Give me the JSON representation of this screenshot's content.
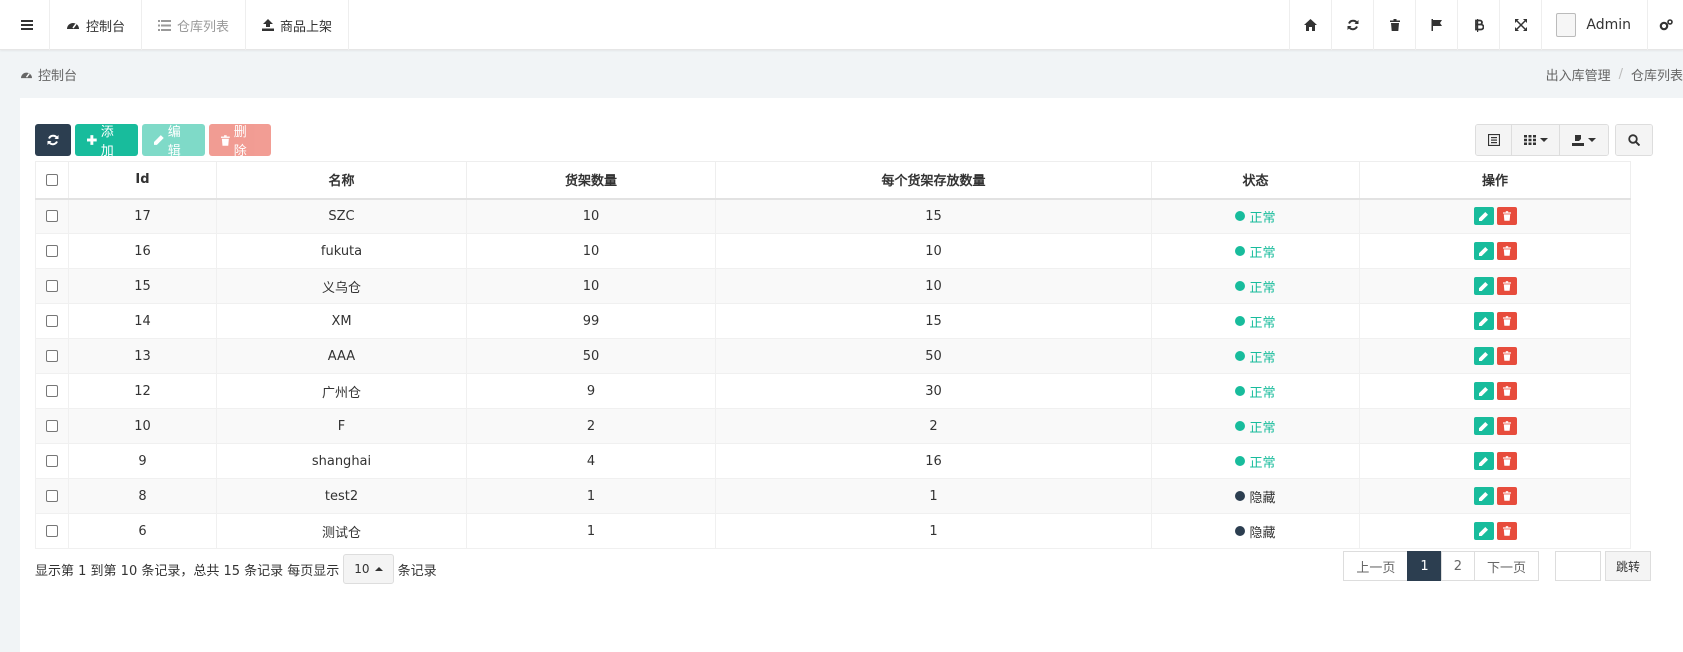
{
  "nav": {
    "tabs": [
      {
        "label": "控制台",
        "icon": "dashboard-icon",
        "active": true
      },
      {
        "label": "仓库列表",
        "icon": "list-icon",
        "active": false
      },
      {
        "label": "商品上架",
        "icon": "upload-icon",
        "active": true
      }
    ],
    "right_icons": [
      "home-icon",
      "refresh-icon",
      "trash-icon",
      "flag-icon",
      "bitcoin-icon",
      "fullscreen-icon"
    ],
    "user_name": "Admin"
  },
  "breadcrumb": {
    "left": "控制台",
    "right": [
      "出入库管理",
      "仓库列表"
    ]
  },
  "toolbar": {
    "add_label": "添加",
    "edit_label": "编辑",
    "delete_label": "删除"
  },
  "table": {
    "headers": [
      "Id",
      "名称",
      "货架数量",
      "每个货架存放数量",
      "状态",
      "操作"
    ],
    "rows": [
      {
        "id": "17",
        "name": "SZC",
        "shelves": "10",
        "per_shelf": "15",
        "status": "正常"
      },
      {
        "id": "16",
        "name": "fukuta",
        "shelves": "10",
        "per_shelf": "10",
        "status": "正常"
      },
      {
        "id": "15",
        "name": "义乌仓",
        "shelves": "10",
        "per_shelf": "10",
        "status": "正常"
      },
      {
        "id": "14",
        "name": "XM",
        "shelves": "99",
        "per_shelf": "15",
        "status": "正常"
      },
      {
        "id": "13",
        "name": "AAA",
        "shelves": "50",
        "per_shelf": "50",
        "status": "正常"
      },
      {
        "id": "12",
        "name": "广州仓",
        "shelves": "9",
        "per_shelf": "30",
        "status": "正常"
      },
      {
        "id": "10",
        "name": "F",
        "shelves": "2",
        "per_shelf": "2",
        "status": "正常"
      },
      {
        "id": "9",
        "name": "shanghai",
        "shelves": "4",
        "per_shelf": "16",
        "status": "正常"
      },
      {
        "id": "8",
        "name": "test2",
        "shelves": "1",
        "per_shelf": "1",
        "status": "隐藏"
      },
      {
        "id": "6",
        "name": "测试仓",
        "shelves": "1",
        "per_shelf": "1",
        "status": "隐藏"
      }
    ]
  },
  "footer": {
    "summary": "显示第 1 到第 10 条记录，总共 15 条记录 每页显示",
    "page_size": "10",
    "suffix": "条记录",
    "pagination": {
      "prev": "上一页",
      "pages": [
        "1",
        "2"
      ],
      "current": "1",
      "next": "下一页",
      "jump": "跳转"
    }
  },
  "colors": {
    "primary_dark": "#2c3e50",
    "success": "#18bc9c",
    "danger": "#e74c3c",
    "status_normal": "#18bc9c",
    "status_hidden": "#2c3e50"
  }
}
